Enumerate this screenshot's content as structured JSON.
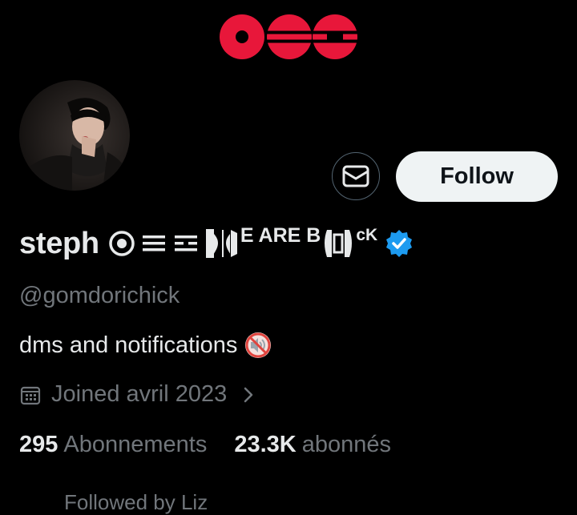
{
  "profile": {
    "display_name": "steph",
    "name_tail_1": "E ARE B",
    "name_tail_2": "cK",
    "handle": "@gomdorichick",
    "bio": "dms and notifications",
    "joined": "Joined avril 2023",
    "stats": {
      "following_count": "295",
      "following_label": "Abonnements",
      "followers_count": "23.3K",
      "followers_label": "abonnés"
    },
    "followed_by": "Followed by Liz"
  },
  "actions": {
    "follow_label": "Follow"
  },
  "icons": {
    "message": "mail-icon",
    "verified": "verified-badge-icon",
    "calendar": "calendar-icon",
    "mute": "speaker-muted-icon",
    "chevron": "chevron-right-icon"
  },
  "colors": {
    "background": "#000000",
    "text": "#e7e9ea",
    "secondary_text": "#71767b",
    "follow_button": "#eff3f4",
    "verified": "#1d9bf0",
    "banner_accent": "#e8173a"
  }
}
